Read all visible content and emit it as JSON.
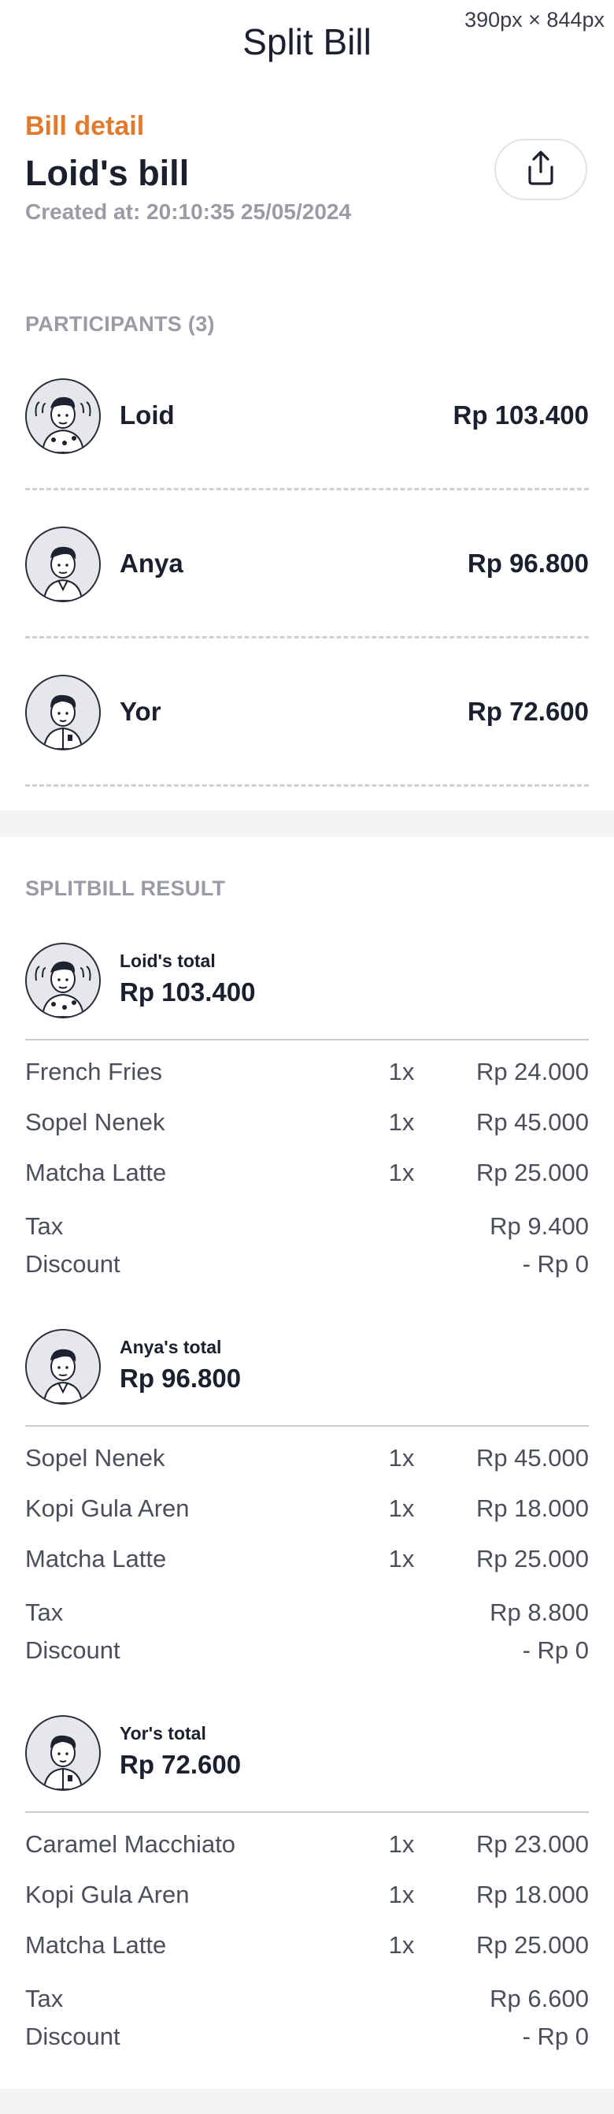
{
  "viewport_label": "390px × 844px",
  "app": {
    "title": "Split Bill"
  },
  "bill": {
    "kicker": "Bill detail",
    "name": "Loid's bill",
    "created": "Created at: 20:10:35 25/05/2024"
  },
  "share_button": {
    "icon": "share-upload-icon"
  },
  "participants": {
    "label": "PARTICIPANTS (3)",
    "items": [
      {
        "name": "Loid",
        "amount": "Rp 103.400",
        "avatar": "loid-avatar"
      },
      {
        "name": "Anya",
        "amount": "Rp 96.800",
        "avatar": "anya-avatar"
      },
      {
        "name": "Yor",
        "amount": "Rp 72.600",
        "avatar": "yor-avatar"
      }
    ]
  },
  "results": {
    "label": "SPLITBILL RESULT",
    "blocks": [
      {
        "caption": "Loid's total",
        "total": "Rp 103.400",
        "items": [
          {
            "name": "French Fries",
            "qty": "1x",
            "price": "Rp 24.000"
          },
          {
            "name": "Sopel Nenek",
            "qty": "1x",
            "price": "Rp 45.000"
          },
          {
            "name": "Matcha Latte",
            "qty": "1x",
            "price": "Rp 25.000"
          }
        ],
        "tax_label": "Tax",
        "tax": "Rp 9.400",
        "discount_label": "Discount",
        "discount": "- Rp 0"
      },
      {
        "caption": "Anya's total",
        "total": "Rp 96.800",
        "items": [
          {
            "name": "Sopel Nenek",
            "qty": "1x",
            "price": "Rp 45.000"
          },
          {
            "name": "Kopi Gula Aren",
            "qty": "1x",
            "price": "Rp 18.000"
          },
          {
            "name": "Matcha Latte",
            "qty": "1x",
            "price": "Rp 25.000"
          }
        ],
        "tax_label": "Tax",
        "tax": "Rp 8.800",
        "discount_label": "Discount",
        "discount": "- Rp 0"
      },
      {
        "caption": "Yor's total",
        "total": "Rp 72.600",
        "items": [
          {
            "name": "Caramel Macchiato",
            "qty": "1x",
            "price": "Rp 23.000"
          },
          {
            "name": "Kopi Gula Aren",
            "qty": "1x",
            "price": "Rp 18.000"
          },
          {
            "name": "Matcha Latte",
            "qty": "1x",
            "price": "Rp 25.000"
          }
        ],
        "tax_label": "Tax",
        "tax": "Rp 6.600",
        "discount_label": "Discount",
        "discount": "- Rp 0"
      }
    ]
  },
  "colors": {
    "accent": "#e07a2e",
    "text_primary": "#1b1f2e",
    "text_muted": "#9a9ca5",
    "divider": "#cfd0d5",
    "band": "#f3f4f6"
  }
}
